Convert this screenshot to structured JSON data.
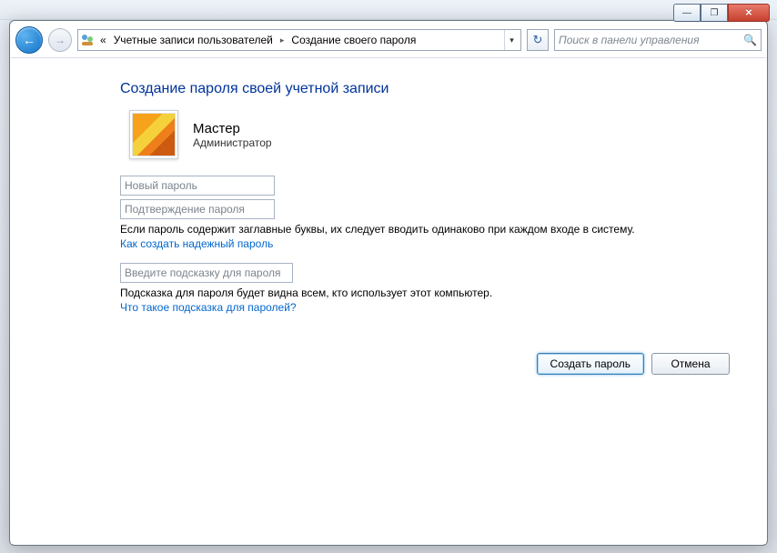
{
  "windowControls": {
    "minimize": "—",
    "maximize": "❐",
    "close": "✕"
  },
  "nav": {
    "backGlyph": "←",
    "fwdGlyph": "→",
    "refreshGlyph": "↻"
  },
  "breadcrumb": {
    "prefix": "«",
    "level1": "Учетные записи пользователей",
    "level2": "Создание своего пароля",
    "sepGlyph": "▸"
  },
  "search": {
    "placeholder": "Поиск в панели управления",
    "magGlyph": "🔍"
  },
  "page": {
    "title": "Создание пароля своей учетной записи"
  },
  "account": {
    "name": "Мастер",
    "role": "Администратор"
  },
  "fields": {
    "newPasswordPlaceholder": "Новый пароль",
    "confirmPasswordPlaceholder": "Подтверждение пароля",
    "hintPlaceholder": "Введите подсказку для пароля"
  },
  "help": {
    "caseNote": "Если пароль содержит заглавные буквы, их следует вводить одинаково при каждом входе в систему.",
    "strongLink": "Как создать надежный пароль",
    "hintNote": "Подсказка для пароля будет видна всем, кто использует этот компьютер.",
    "hintLink": "Что такое подсказка для паролей?"
  },
  "buttons": {
    "create": "Создать пароль",
    "cancel": "Отмена"
  }
}
